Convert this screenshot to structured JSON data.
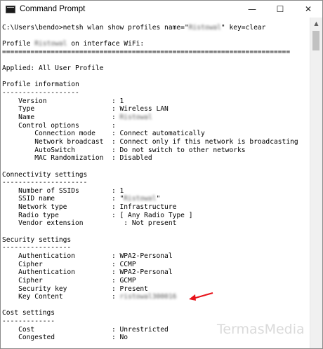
{
  "window": {
    "title": "Command Prompt",
    "icon": "console-icon",
    "controls": {
      "minimize": "—",
      "maximize": "☐",
      "close": "✕"
    }
  },
  "console": {
    "lines": [
      {
        "text": "C:\\Users\\bendo>netsh wlan show profiles name=\"Ristowal\" key=clear",
        "blur": "Ristowal"
      },
      {
        "text": ""
      },
      {
        "text": "Profile Ristowal on interface WiFi:",
        "blur": "Ristowal"
      },
      {
        "text": "======================================================================="
      },
      {
        "text": ""
      },
      {
        "text": "Applied: All User Profile"
      },
      {
        "text": ""
      },
      {
        "text": "Profile information"
      },
      {
        "text": "-------------------"
      },
      {
        "text": "    Version                : 1"
      },
      {
        "text": "    Type                   : Wireless LAN"
      },
      {
        "text": "    Name                   : Ristowal",
        "blur": "Ristowal"
      },
      {
        "text": "    Control options        :"
      },
      {
        "text": "        Connection mode    : Connect automatically"
      },
      {
        "text": "        Network broadcast  : Connect only if this network is broadcasting"
      },
      {
        "text": "        AutoSwitch         : Do not switch to other networks"
      },
      {
        "text": "        MAC Randomization  : Disabled"
      },
      {
        "text": ""
      },
      {
        "text": "Connectivity settings"
      },
      {
        "text": "---------------------"
      },
      {
        "text": "    Number of SSIDs        : 1"
      },
      {
        "text": "    SSID name              : \"Ristowal\"",
        "blur": "Ristowal"
      },
      {
        "text": "    Network type           : Infrastructure"
      },
      {
        "text": "    Radio type             : [ Any Radio Type ]"
      },
      {
        "text": "    Vendor extension          : Not present"
      },
      {
        "text": ""
      },
      {
        "text": "Security settings"
      },
      {
        "text": "-----------------"
      },
      {
        "text": "    Authentication         : WPA2-Personal"
      },
      {
        "text": "    Cipher                 : CCMP"
      },
      {
        "text": "    Authentication         : WPA2-Personal"
      },
      {
        "text": "    Cipher                 : GCMP"
      },
      {
        "text": "    Security key           : Present"
      },
      {
        "text": "    Key Content            : ristowal300016",
        "blur": "ristowal300016"
      },
      {
        "text": ""
      },
      {
        "text": "Cost settings"
      },
      {
        "text": "-------------"
      },
      {
        "text": "    Cost                   : Unrestricted"
      },
      {
        "text": "    Congested              : No"
      }
    ]
  },
  "scrollbar": {
    "up_arrow": "▲"
  },
  "annotation": {
    "arrow_color": "#e8141b"
  },
  "watermark": {
    "text": "TermasMedia"
  }
}
